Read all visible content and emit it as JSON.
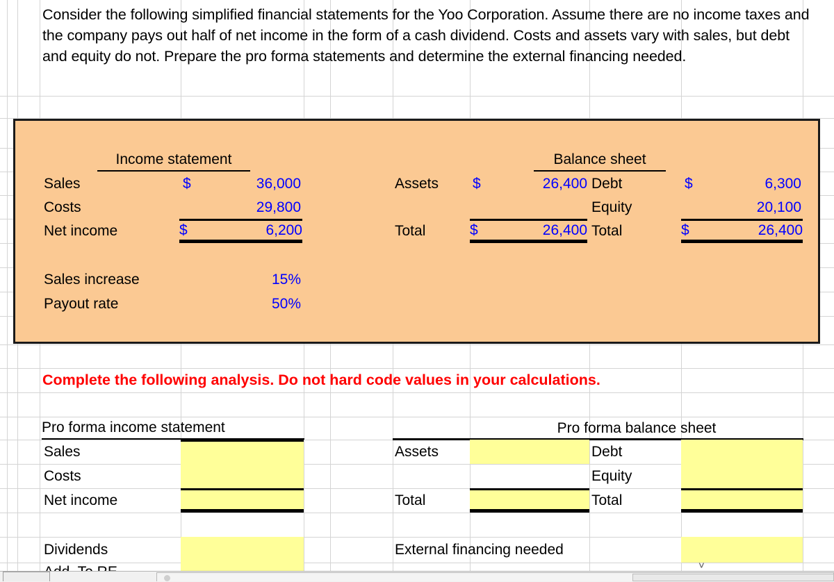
{
  "problem": {
    "text": "Consider the following simplified financial statements for the Yoo Corporation. Assume there are no income taxes and the company pays out half of net income in the form of a cash dividend. Costs and assets vary with sales, but debt and equity do not. Prepare the pro forma statements and determine the external financing needed."
  },
  "given": {
    "income_statement": {
      "title": "Income statement",
      "rows": [
        {
          "label": "Sales",
          "currency": "$",
          "value": "36,000"
        },
        {
          "label": "Costs",
          "currency": "",
          "value": "29,800"
        },
        {
          "label": "Net income",
          "currency": "$",
          "value": "6,200"
        }
      ]
    },
    "balance_sheet": {
      "title": "Balance sheet",
      "left_rows": [
        {
          "label": "Assets",
          "currency": "$",
          "value": "26,400"
        },
        {
          "label": "",
          "currency": "",
          "value": ""
        },
        {
          "label": "Total",
          "currency": "$",
          "value": "26,400"
        }
      ],
      "right_rows": [
        {
          "label": "Debt",
          "currency": "$",
          "value": "6,300"
        },
        {
          "label": "Equity",
          "currency": "",
          "value": "20,100"
        },
        {
          "label": "Total",
          "currency": "$",
          "value": "26,400"
        }
      ]
    },
    "assumptions": [
      {
        "label": "Sales increase",
        "value": "15%"
      },
      {
        "label": "Payout rate",
        "value": "50%"
      }
    ]
  },
  "instruction": {
    "text": "Complete the following analysis. Do not hard code values in your calculations.",
    "color": "#ff0000"
  },
  "proforma": {
    "income_statement": {
      "title": "Pro forma income statement",
      "rows": [
        {
          "label": "Sales",
          "value": ""
        },
        {
          "label": "Costs",
          "value": ""
        },
        {
          "label": "Net income",
          "value": ""
        }
      ],
      "extra_rows": [
        {
          "label": "Dividends",
          "value": ""
        },
        {
          "label": "Add. To RE",
          "value": ""
        }
      ]
    },
    "balance_sheet": {
      "title": "Pro forma balance sheet",
      "left_rows": [
        {
          "label": "Assets",
          "value": ""
        },
        {
          "label": "",
          "value": ""
        },
        {
          "label": "Total",
          "value": ""
        }
      ],
      "right_rows": [
        {
          "label": "Debt",
          "value": ""
        },
        {
          "label": "Equity",
          "value": ""
        },
        {
          "label": "Total",
          "value": ""
        }
      ],
      "efn": {
        "label": "External financing needed",
        "value": ""
      }
    }
  },
  "theme": {
    "panel_fill": "#fbc993",
    "input_fill": "#ffff99",
    "value_color": "#0000ff",
    "gridline": "#d4d4d4"
  }
}
